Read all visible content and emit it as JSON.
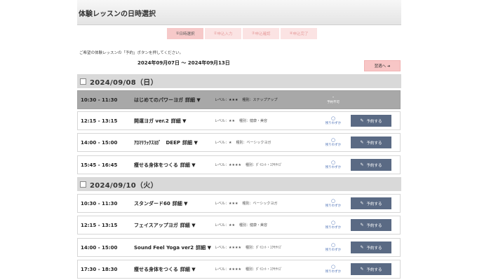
{
  "page_title": "体験レッスンの日時選択",
  "steps": [
    {
      "num": "①",
      "label": "日時選択",
      "active": true
    },
    {
      "num": "②",
      "label": "申込入力",
      "active": false
    },
    {
      "num": "③",
      "label": "申込確認",
      "active": false
    },
    {
      "num": "④",
      "label": "申込完了",
      "active": false
    }
  ],
  "instruction": "ご希望の体験レッスンの「予約」ボタンを押してください。",
  "date_range": "2024年09月07日 ～ 2024年09月13日",
  "next_button": "翌週へ ➜",
  "days": [
    {
      "date": "2024/09/08（日）",
      "lessons": [
        {
          "time": "10:30 - 11:30",
          "title": "はじめてのパワーヨガ",
          "detail": "詳細 ▼",
          "level": "レベル：★★★",
          "kind": "種別：ステップアップ",
          "mark": "-",
          "status": "予約不可",
          "reserve": ""
        },
        {
          "time": "12:15 - 13:15",
          "title": "開運ヨガ ver.2",
          "detail": "詳細 ▼",
          "level": "レベル：★★",
          "kind": "種別：健康・美容",
          "mark": "○",
          "status": "残りわずか",
          "reserve": "予約する"
        },
        {
          "time": "14:00 - 15:00",
          "title": "ｱﾛﾏﾘﾗｯｸｽﾖｶﾞ　DEEP",
          "detail": "詳細 ▼",
          "level": "レベル：★",
          "kind": "種別：ベーシックヨガ",
          "mark": "○",
          "status": "残りわずか",
          "reserve": "予約する"
        },
        {
          "time": "15:45 - 16:45",
          "title": "痩せる身体をつくる",
          "detail": "詳細 ▼",
          "level": "レベル：★★★★",
          "kind": "種別：ﾀﾞｲｴｯﾄ・ｴｸｻｻｲｽﾞ",
          "mark": "○",
          "status": "残りわずか",
          "reserve": "予約する"
        }
      ]
    },
    {
      "date": "2024/09/10（火）",
      "lessons": [
        {
          "time": "10:30 - 11:30",
          "title": "スタンダード60",
          "detail": "詳細 ▼",
          "level": "レベル：★★★",
          "kind": "種別：ベーシックヨガ",
          "mark": "○",
          "status": "残りわずか",
          "reserve": "予約する"
        },
        {
          "time": "12:15 - 13:15",
          "title": "フェイスアップヨガ",
          "detail": "詳細 ▼",
          "level": "レベル：★★",
          "kind": "種別：健康・美容",
          "mark": "○",
          "status": "残りわずか",
          "reserve": "予約する"
        },
        {
          "time": "14:00 - 15:00",
          "title": "Sound Feel Yoga ver2",
          "detail": "詳細 ▼",
          "level": "レベル：★★★★",
          "kind": "種別：ﾀﾞｲｴｯﾄ・ｴｸｻｻｲｽﾞ",
          "mark": "○",
          "status": "残りわずか",
          "reserve": "予約する"
        },
        {
          "time": "17:30 - 18:30",
          "title": "痩せる身体をつくる",
          "detail": "詳細 ▼",
          "level": "レベル：★★★★",
          "kind": "種別：ﾀﾞｲｴｯﾄ・ｴｸｻｻｲｽﾞ",
          "mark": "○",
          "status": "残りわずか",
          "reserve": "予約する"
        }
      ]
    }
  ]
}
